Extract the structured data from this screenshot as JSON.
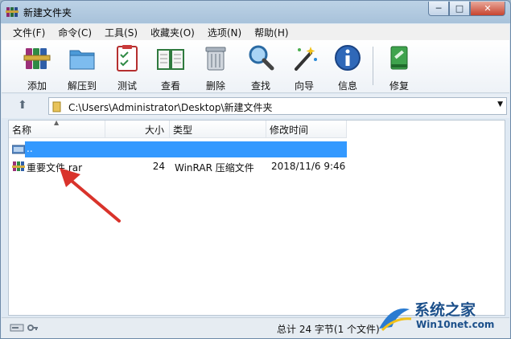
{
  "window": {
    "title": "新建文件夹",
    "controls": {
      "minimize": "─",
      "maximize": "□",
      "close": "✕"
    }
  },
  "menu": [
    "文件(F)",
    "命令(C)",
    "工具(S)",
    "收藏夹(O)",
    "选项(N)",
    "帮助(H)"
  ],
  "toolbar": [
    {
      "label": "添加",
      "icon": "books-stack-icon"
    },
    {
      "label": "解压到",
      "icon": "folder-extract-icon"
    },
    {
      "label": "测试",
      "icon": "checklist-clipboard-icon"
    },
    {
      "label": "查看",
      "icon": "open-book-icon"
    },
    {
      "label": "删除",
      "icon": "trash-can-icon"
    },
    {
      "label": "查找",
      "icon": "magnifier-icon"
    },
    {
      "label": "向导",
      "icon": "magic-wand-icon"
    },
    {
      "label": "信息",
      "icon": "info-icon"
    },
    {
      "label": "修复",
      "icon": "repair-kit-icon"
    }
  ],
  "address": {
    "path": "C:\\Users\\Administrator\\Desktop\\新建文件夹"
  },
  "columns": {
    "name": "名称",
    "size": "大小",
    "type": "类型",
    "modified": "修改时间"
  },
  "rows": [
    {
      "name": "..",
      "size": "",
      "type": "",
      "modified": "",
      "selected": true
    },
    {
      "name": "重要文件.rar",
      "size": "24",
      "type": "WinRAR 压缩文件",
      "modified": "2018/11/6 9:46",
      "selected": false
    }
  ],
  "status": {
    "text": "总计 24 字节(1 个文件)"
  },
  "watermark": {
    "title": "系统之家",
    "site": "Win10net.com"
  },
  "colors": {
    "selection": "#3399ff",
    "annotation_arrow": "#d9332b",
    "watermark": "#1b4f8a"
  }
}
